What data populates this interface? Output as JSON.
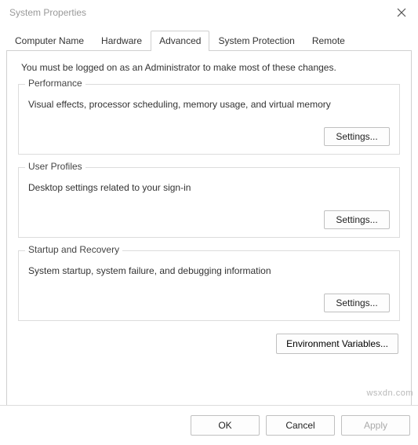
{
  "window": {
    "title": "System Properties"
  },
  "tabs": {
    "computer_name": "Computer Name",
    "hardware": "Hardware",
    "advanced": "Advanced",
    "system_protection": "System Protection",
    "remote": "Remote"
  },
  "intro": "You must be logged on as an Administrator to make most of these changes.",
  "groups": {
    "performance": {
      "title": "Performance",
      "desc": "Visual effects, processor scheduling, memory usage, and virtual memory",
      "button": "Settings..."
    },
    "user_profiles": {
      "title": "User Profiles",
      "desc": "Desktop settings related to your sign-in",
      "button": "Settings..."
    },
    "startup": {
      "title": "Startup and Recovery",
      "desc": "System startup, system failure, and debugging information",
      "button": "Settings..."
    }
  },
  "env_button": "Environment Variables...",
  "footer": {
    "ok": "OK",
    "cancel": "Cancel",
    "apply": "Apply"
  },
  "watermark": "wsxdn.com"
}
